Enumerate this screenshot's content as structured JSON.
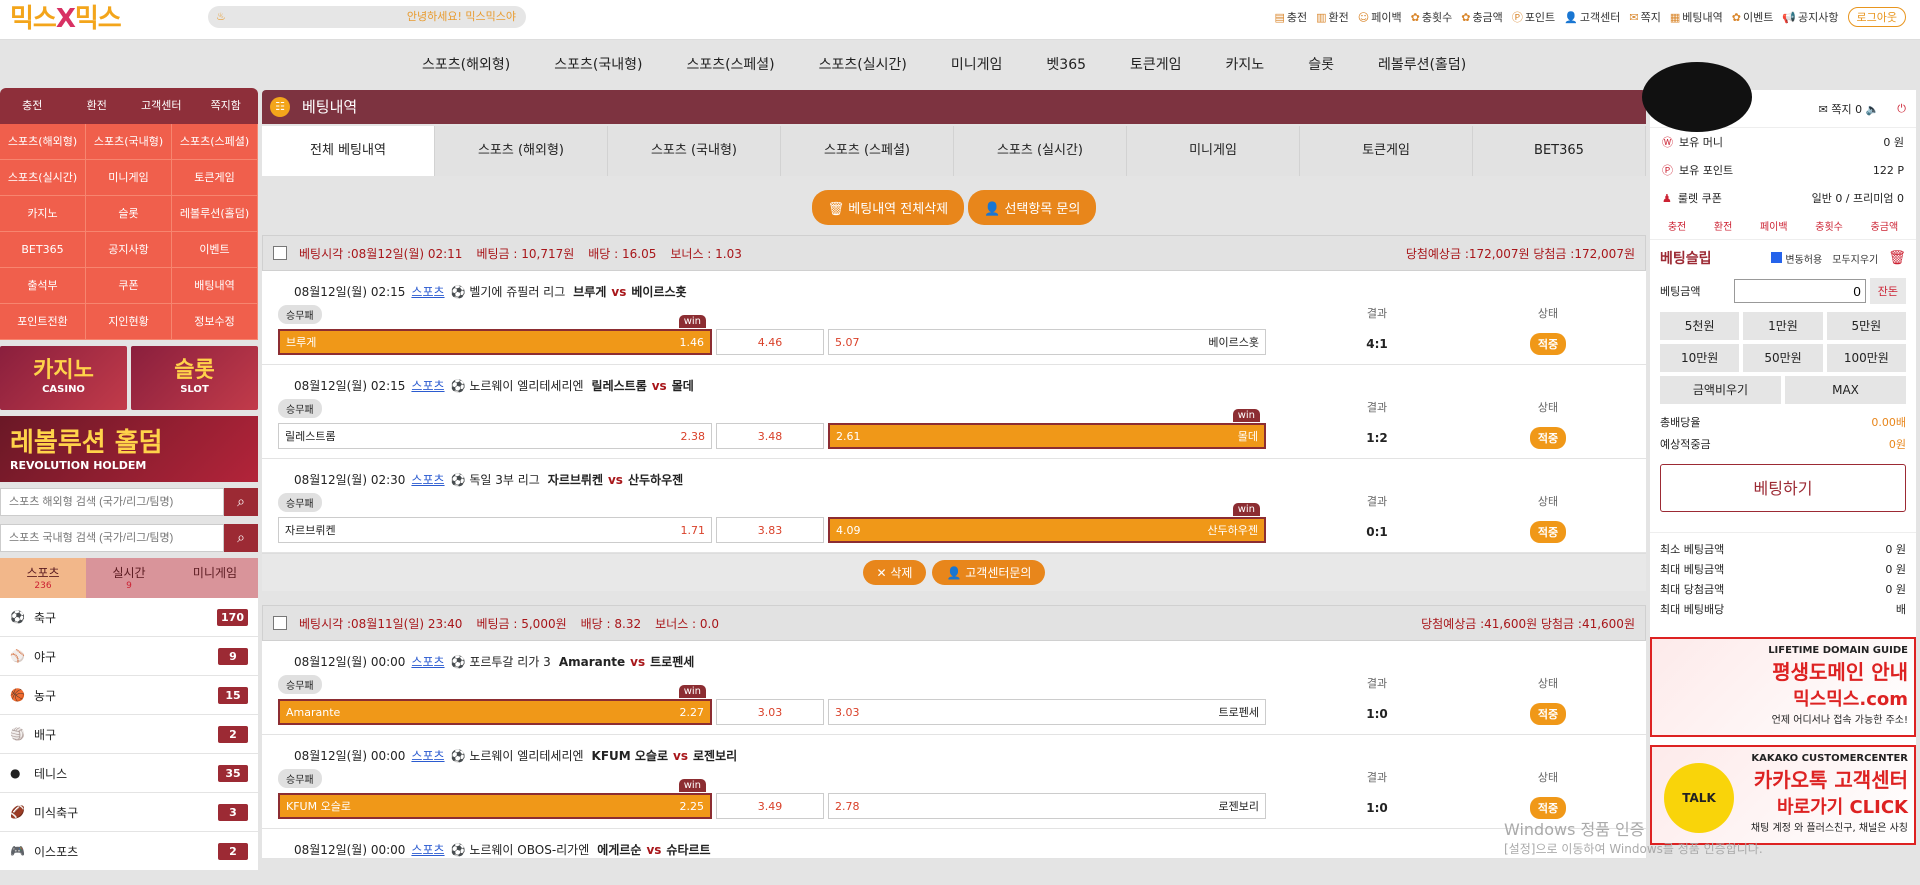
{
  "logo": {
    "a": "믹스",
    "x": "X",
    "b": "믹스"
  },
  "greeting": "안녕하세요! 믹스믹스야",
  "top_links": [
    "충전",
    "환전",
    "페이백",
    "충횟수",
    "충금액",
    "포인트",
    "고객센터",
    "쪽지",
    "베팅내역",
    "이벤트",
    "공지사항"
  ],
  "logout": "로그아웃",
  "gnb": [
    "스포츠(해외형)",
    "스포츠(국내형)",
    "스포츠(스페셜)",
    "스포츠(실시간)",
    "미니게임",
    "벳365",
    "토큰게임",
    "카지노",
    "슬롯",
    "레볼루션(홀덤)"
  ],
  "left": {
    "tabs": [
      "충전",
      "환전",
      "고객센터",
      "쪽지함"
    ],
    "grid": [
      "스포츠(해외형)",
      "스포츠(국내형)",
      "스포츠(스페셜)",
      "스포츠(실시간)",
      "미니게임",
      "토큰게임",
      "카지노",
      "슬롯",
      "레볼루션(홀덤)",
      "BET365",
      "공지사항",
      "이벤트",
      "출석부",
      "쿠폰",
      "배팅내역",
      "포인트전환",
      "지인현황",
      "정보수정"
    ],
    "banner_casino": "카지노",
    "banner_casino_sub": "CASINO",
    "banner_slot": "슬롯",
    "banner_slot_sub": "SLOT",
    "banner_holdem": "레볼루션 홀덤",
    "banner_holdem_sub": "REVOLUTION HOLDEM",
    "search1": "스포츠 해외형 검색 (국가/리그/팀명)",
    "search2": "스포츠 국내형 검색 (국가/리그/팀명)",
    "cat_tabs": [
      {
        "label": "스포츠",
        "count": "236"
      },
      {
        "label": "실시간",
        "count": "9"
      },
      {
        "label": "미니게임",
        "count": ""
      }
    ],
    "sports": [
      {
        "name": "축구",
        "count": "170"
      },
      {
        "name": "야구",
        "count": "9"
      },
      {
        "name": "농구",
        "count": "15"
      },
      {
        "name": "배구",
        "count": "2"
      },
      {
        "name": "테니스",
        "count": "35"
      },
      {
        "name": "미식축구",
        "count": "3"
      },
      {
        "name": "이스포츠",
        "count": "2"
      }
    ]
  },
  "main": {
    "title": "베팅내역",
    "tabs": [
      "전체 베팅내역",
      "스포츠 (해외형)",
      "스포츠 (국내형)",
      "스포츠 (스페셜)",
      "스포츠 (실시간)",
      "미니게임",
      "토큰게임",
      "BET365"
    ],
    "btn_delete_all": "베팅내역 전체삭제",
    "btn_inquiry": "선택항목 문의",
    "lbl_result": "결과",
    "lbl_status": "상태",
    "lbl_market": "승무패",
    "vs": "vs",
    "win": "win",
    "status": "적중",
    "slip1": {
      "head": "베팅시각 :08월12일(월) 02:11",
      "amt": "베팅금 : 10,717원",
      "odds": "배당 : 16.05",
      "bonus": "보너스 : 1.03",
      "right": "당첨예상금 :172,007원  당첨금 :172,007원",
      "games": [
        {
          "time": "08월12일(월) 02:15",
          "sport": "스포츠",
          "league": "벨기에 쥬필러 리그",
          "home": "브루게",
          "away": "베이르스홋",
          "h": "1.46",
          "d": "4.46",
          "a": "5.07",
          "score": "4:1",
          "sel": 0
        },
        {
          "time": "08월12일(월) 02:15",
          "sport": "스포츠",
          "league": "노르웨이 엘리테세리엔",
          "home": "릴레스트롬",
          "away": "몰데",
          "h": "2.38",
          "d": "3.48",
          "a": "2.61",
          "score": "1:2",
          "sel": 2
        },
        {
          "time": "08월12일(월) 02:30",
          "sport": "스포츠",
          "league": "독일 3부 리그",
          "home": "자르브뤼켄",
          "away": "산두하우젠",
          "h": "1.71",
          "d": "3.83",
          "a": "4.09",
          "score": "0:1",
          "sel": 2
        }
      ]
    },
    "btn_delete": "삭제",
    "btn_cs": "고객센터문의",
    "slip2": {
      "head": "베팅시각 :08월11일(일) 23:40",
      "amt": "베팅금 : 5,000원",
      "odds": "배당 : 8.32",
      "bonus": "보너스 : 0.0",
      "right": "당첨예상금 :41,600원  당첨금 :41,600원",
      "games": [
        {
          "time": "08월12일(월) 00:00",
          "sport": "스포츠",
          "league": "포르투갈 리가 3",
          "home": "Amarante",
          "away": "트로펜세",
          "h": "2.27",
          "d": "3.03",
          "a": "3.03",
          "score": "1:0",
          "sel": 0
        },
        {
          "time": "08월12일(월) 00:00",
          "sport": "스포츠",
          "league": "노르웨이 엘리테세리엔",
          "home": "KFUM 오슬로",
          "away": "로젠보리",
          "h": "2.25",
          "d": "3.49",
          "a": "2.78",
          "score": "1:0",
          "sel": 0
        },
        {
          "time": "08월12일(월) 00:00",
          "sport": "스포츠",
          "league": "노르웨이 OBOS-리가엔",
          "home": "에게르순",
          "away": "슈타르트",
          "h": "",
          "d": "",
          "a": "",
          "score": "",
          "sel": -1
        }
      ]
    }
  },
  "right": {
    "msg": "쪽지 0",
    "money_lbl": "보유 머니",
    "money": "0 원",
    "point_lbl": "보유 포인트",
    "point": "122 P",
    "coupon_lbl": "룰렛 쿠폰",
    "coupon": "일반 0 / 프리미엄 0",
    "mini": [
      "충전",
      "환전",
      "페이백",
      "충횟수",
      "충금액"
    ],
    "slip_title": "베팅슬립",
    "allow": "변동허용",
    "clear": "모두지우기",
    "amt_lbl": "베팅금액",
    "amt": "0",
    "confirm": "잔돈",
    "chips": [
      "5천원",
      "1만원",
      "5만원",
      "10만원",
      "50만원",
      "100만원"
    ],
    "chips2": [
      "금액비우기",
      "MAX"
    ],
    "total_odds_lbl": "총배당율",
    "total_odds": "0.00배",
    "expect_lbl": "예상적중금",
    "expect": "0원",
    "bet_btn": "베팅하기",
    "limits": [
      {
        "l": "최소 베팅금액",
        "v": "0 원"
      },
      {
        "l": "최대 베팅금액",
        "v": "0 원"
      },
      {
        "l": "최대 당첨금액",
        "v": "0 원"
      },
      {
        "l": "최대 베팅배당",
        "v": "배"
      }
    ],
    "ban1_t": "LIFETIME DOMAIN GUIDE",
    "ban1_h": "평생도메인 안내",
    "ban1_h2": "믹스믹스.com",
    "ban1_s": "언제 어디서나 접속 가능한 주소!",
    "ban2_t": "KAKAKO CUSTOMERCENTER",
    "ban2_k": "TALK",
    "ban2_h": "카카오톡 고객센터",
    "ban2_h2": "바로가기 CLICK",
    "ban2_s": "채팅 계정 와 플러스친구, 채널은 사칭"
  },
  "watermark": "Windows 정품 인증",
  "watermark_sub": "[설정]으로 이동하여 Windows를 정품 인증합니다."
}
